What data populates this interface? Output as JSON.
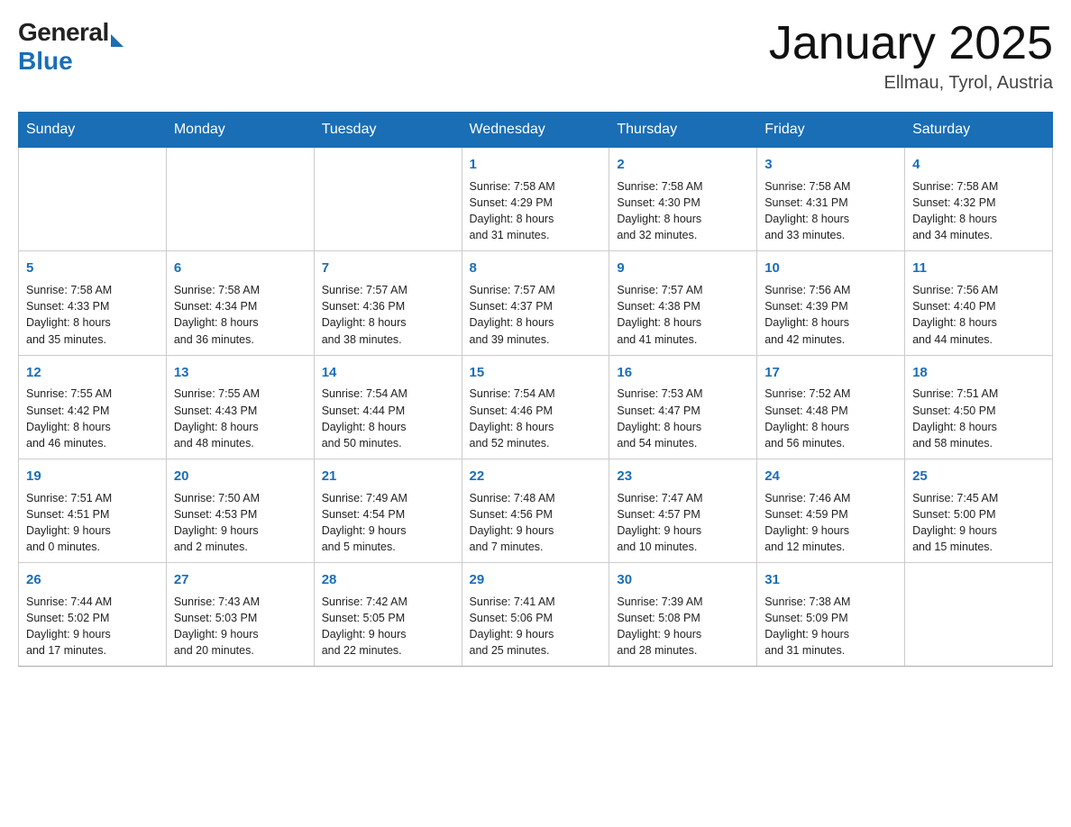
{
  "header": {
    "logo_general": "General",
    "logo_blue": "Blue",
    "month_title": "January 2025",
    "location": "Ellmau, Tyrol, Austria"
  },
  "days_of_week": [
    "Sunday",
    "Monday",
    "Tuesday",
    "Wednesday",
    "Thursday",
    "Friday",
    "Saturday"
  ],
  "weeks": [
    [
      {
        "day": "",
        "info": ""
      },
      {
        "day": "",
        "info": ""
      },
      {
        "day": "",
        "info": ""
      },
      {
        "day": "1",
        "info": "Sunrise: 7:58 AM\nSunset: 4:29 PM\nDaylight: 8 hours\nand 31 minutes."
      },
      {
        "day": "2",
        "info": "Sunrise: 7:58 AM\nSunset: 4:30 PM\nDaylight: 8 hours\nand 32 minutes."
      },
      {
        "day": "3",
        "info": "Sunrise: 7:58 AM\nSunset: 4:31 PM\nDaylight: 8 hours\nand 33 minutes."
      },
      {
        "day": "4",
        "info": "Sunrise: 7:58 AM\nSunset: 4:32 PM\nDaylight: 8 hours\nand 34 minutes."
      }
    ],
    [
      {
        "day": "5",
        "info": "Sunrise: 7:58 AM\nSunset: 4:33 PM\nDaylight: 8 hours\nand 35 minutes."
      },
      {
        "day": "6",
        "info": "Sunrise: 7:58 AM\nSunset: 4:34 PM\nDaylight: 8 hours\nand 36 minutes."
      },
      {
        "day": "7",
        "info": "Sunrise: 7:57 AM\nSunset: 4:36 PM\nDaylight: 8 hours\nand 38 minutes."
      },
      {
        "day": "8",
        "info": "Sunrise: 7:57 AM\nSunset: 4:37 PM\nDaylight: 8 hours\nand 39 minutes."
      },
      {
        "day": "9",
        "info": "Sunrise: 7:57 AM\nSunset: 4:38 PM\nDaylight: 8 hours\nand 41 minutes."
      },
      {
        "day": "10",
        "info": "Sunrise: 7:56 AM\nSunset: 4:39 PM\nDaylight: 8 hours\nand 42 minutes."
      },
      {
        "day": "11",
        "info": "Sunrise: 7:56 AM\nSunset: 4:40 PM\nDaylight: 8 hours\nand 44 minutes."
      }
    ],
    [
      {
        "day": "12",
        "info": "Sunrise: 7:55 AM\nSunset: 4:42 PM\nDaylight: 8 hours\nand 46 minutes."
      },
      {
        "day": "13",
        "info": "Sunrise: 7:55 AM\nSunset: 4:43 PM\nDaylight: 8 hours\nand 48 minutes."
      },
      {
        "day": "14",
        "info": "Sunrise: 7:54 AM\nSunset: 4:44 PM\nDaylight: 8 hours\nand 50 minutes."
      },
      {
        "day": "15",
        "info": "Sunrise: 7:54 AM\nSunset: 4:46 PM\nDaylight: 8 hours\nand 52 minutes."
      },
      {
        "day": "16",
        "info": "Sunrise: 7:53 AM\nSunset: 4:47 PM\nDaylight: 8 hours\nand 54 minutes."
      },
      {
        "day": "17",
        "info": "Sunrise: 7:52 AM\nSunset: 4:48 PM\nDaylight: 8 hours\nand 56 minutes."
      },
      {
        "day": "18",
        "info": "Sunrise: 7:51 AM\nSunset: 4:50 PM\nDaylight: 8 hours\nand 58 minutes."
      }
    ],
    [
      {
        "day": "19",
        "info": "Sunrise: 7:51 AM\nSunset: 4:51 PM\nDaylight: 9 hours\nand 0 minutes."
      },
      {
        "day": "20",
        "info": "Sunrise: 7:50 AM\nSunset: 4:53 PM\nDaylight: 9 hours\nand 2 minutes."
      },
      {
        "day": "21",
        "info": "Sunrise: 7:49 AM\nSunset: 4:54 PM\nDaylight: 9 hours\nand 5 minutes."
      },
      {
        "day": "22",
        "info": "Sunrise: 7:48 AM\nSunset: 4:56 PM\nDaylight: 9 hours\nand 7 minutes."
      },
      {
        "day": "23",
        "info": "Sunrise: 7:47 AM\nSunset: 4:57 PM\nDaylight: 9 hours\nand 10 minutes."
      },
      {
        "day": "24",
        "info": "Sunrise: 7:46 AM\nSunset: 4:59 PM\nDaylight: 9 hours\nand 12 minutes."
      },
      {
        "day": "25",
        "info": "Sunrise: 7:45 AM\nSunset: 5:00 PM\nDaylight: 9 hours\nand 15 minutes."
      }
    ],
    [
      {
        "day": "26",
        "info": "Sunrise: 7:44 AM\nSunset: 5:02 PM\nDaylight: 9 hours\nand 17 minutes."
      },
      {
        "day": "27",
        "info": "Sunrise: 7:43 AM\nSunset: 5:03 PM\nDaylight: 9 hours\nand 20 minutes."
      },
      {
        "day": "28",
        "info": "Sunrise: 7:42 AM\nSunset: 5:05 PM\nDaylight: 9 hours\nand 22 minutes."
      },
      {
        "day": "29",
        "info": "Sunrise: 7:41 AM\nSunset: 5:06 PM\nDaylight: 9 hours\nand 25 minutes."
      },
      {
        "day": "30",
        "info": "Sunrise: 7:39 AM\nSunset: 5:08 PM\nDaylight: 9 hours\nand 28 minutes."
      },
      {
        "day": "31",
        "info": "Sunrise: 7:38 AM\nSunset: 5:09 PM\nDaylight: 9 hours\nand 31 minutes."
      },
      {
        "day": "",
        "info": ""
      }
    ]
  ]
}
